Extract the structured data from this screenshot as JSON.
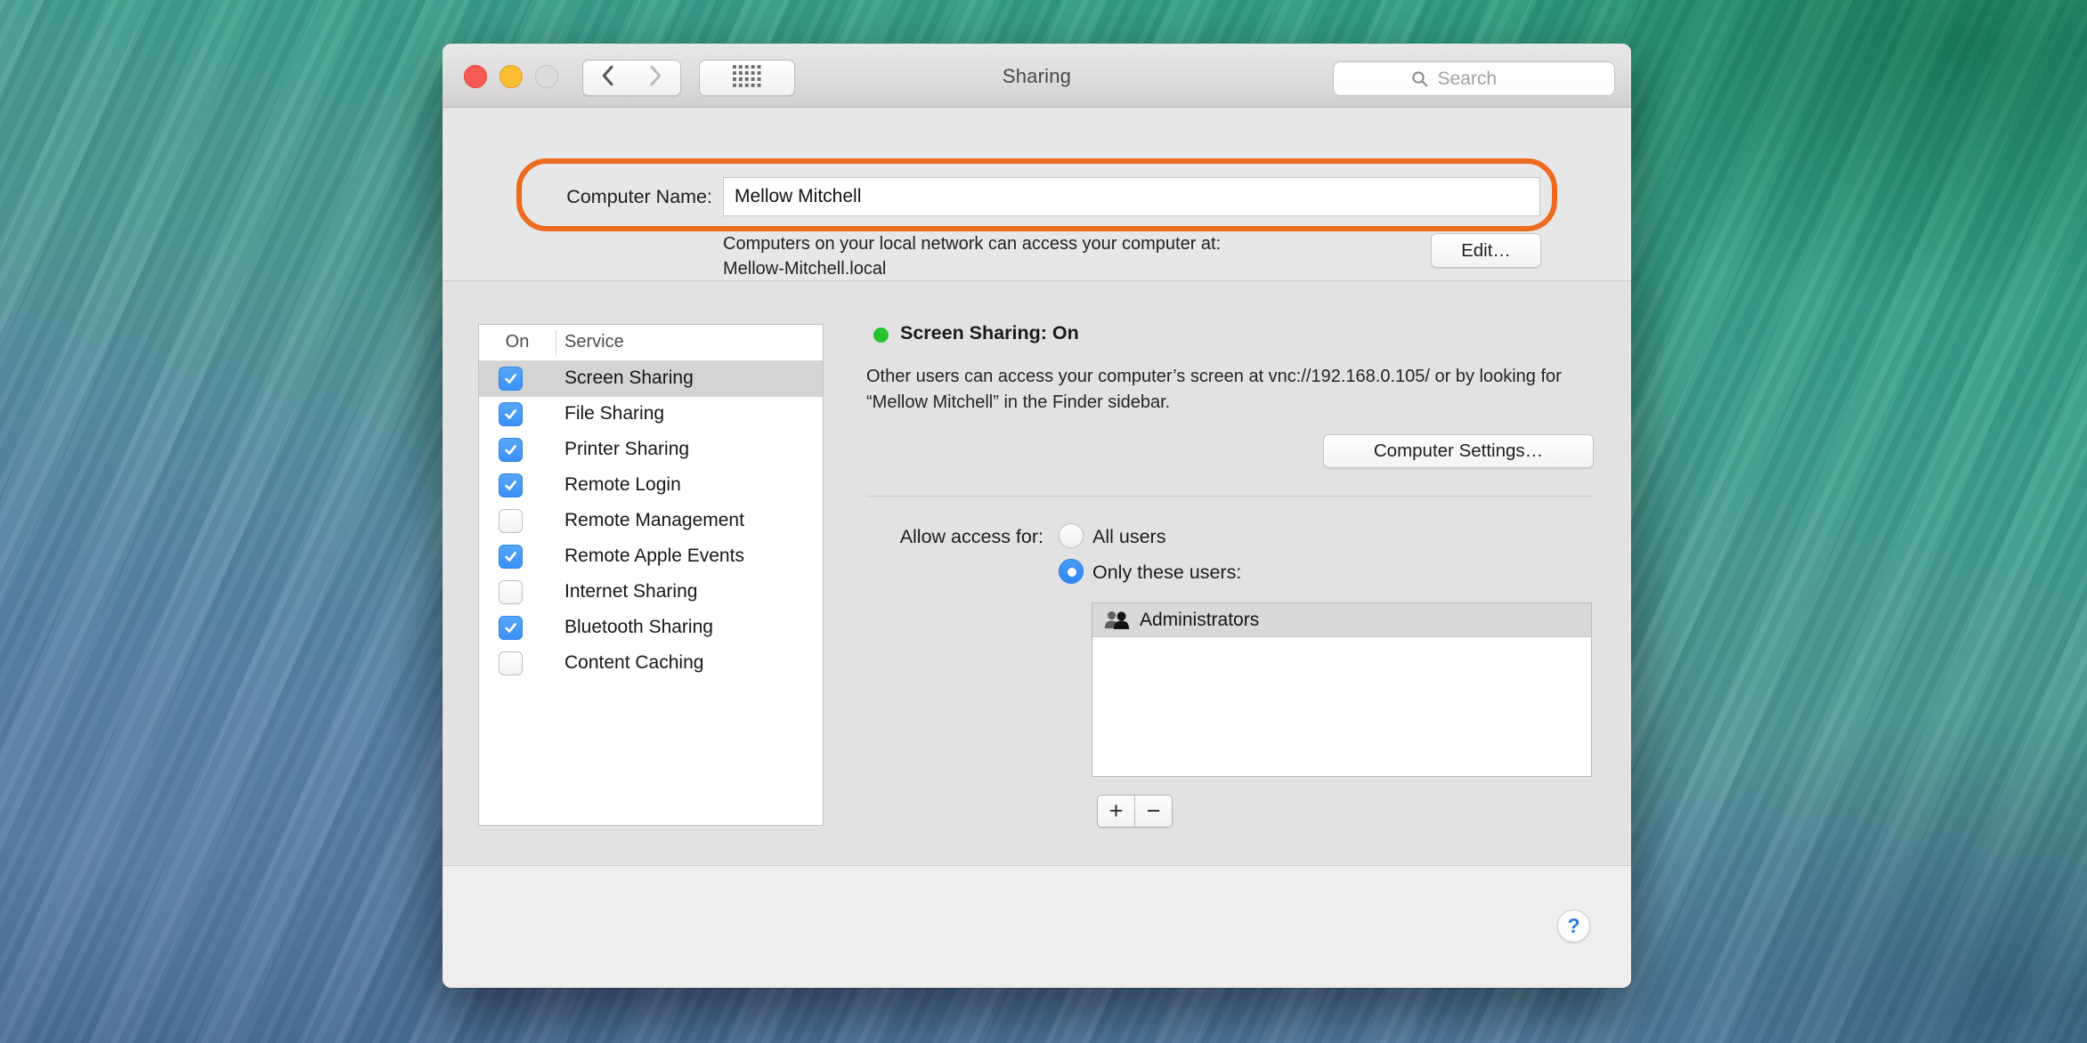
{
  "titlebar": {
    "title": "Sharing",
    "search_placeholder": "Search"
  },
  "icons": {
    "close": "traffic-light-red",
    "minimize": "traffic-light-yellow",
    "zoom": "traffic-light-gray-disabled",
    "back": "chevron-left",
    "forward": "chevron-right-disabled",
    "show_all": "grid-of-squares",
    "search": "magnifier",
    "status": "green-dot",
    "users_group": "two-people-silhouette",
    "help": "question-mark"
  },
  "computer_name": {
    "label": "Computer Name:",
    "value": "Mellow Mitchell",
    "description": "Computers on your local network can access your computer at:",
    "local_hostname": "Mellow-Mitchell.local",
    "edit_button": "Edit…"
  },
  "services": {
    "columns": {
      "on": "On",
      "service": "Service"
    },
    "items": [
      {
        "label": "Screen Sharing",
        "checked": true,
        "selected": true
      },
      {
        "label": "File Sharing",
        "checked": true,
        "selected": false
      },
      {
        "label": "Printer Sharing",
        "checked": true,
        "selected": false
      },
      {
        "label": "Remote Login",
        "checked": true,
        "selected": false
      },
      {
        "label": "Remote Management",
        "checked": false,
        "selected": false
      },
      {
        "label": "Remote Apple Events",
        "checked": true,
        "selected": false
      },
      {
        "label": "Internet Sharing",
        "checked": false,
        "selected": false
      },
      {
        "label": "Bluetooth Sharing",
        "checked": true,
        "selected": false
      },
      {
        "label": "Content Caching",
        "checked": false,
        "selected": false
      }
    ]
  },
  "detail": {
    "status_title": "Screen Sharing: On",
    "description": "Other users can access your computer’s screen at vnc://192.168.0.105/ or by looking for “Mellow Mitchell” in the Finder sidebar.",
    "computer_settings_button": "Computer Settings…",
    "allow_access_label": "Allow access for:",
    "radio_all_users": {
      "label": "All users",
      "selected": false
    },
    "radio_only_these_users": {
      "label": "Only these users:",
      "selected": true
    },
    "users": [
      {
        "name": "Administrators"
      }
    ],
    "add_button": "+",
    "remove_button": "−"
  },
  "footer": {
    "help_label": "?"
  },
  "colors": {
    "accent_blue": "#3b92f6",
    "status_green": "#27c32f",
    "annotation_orange": "#ed6a1e",
    "selected_row_gray": "#d4d4d4"
  }
}
